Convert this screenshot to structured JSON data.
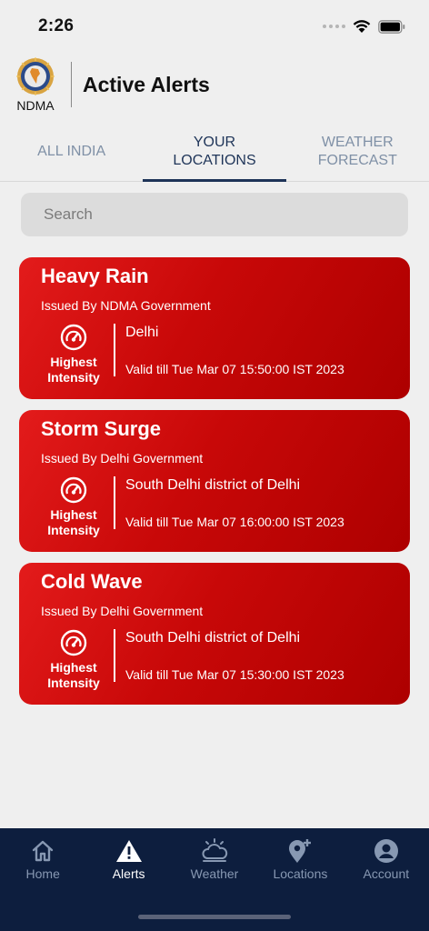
{
  "status_bar": {
    "time": "2:26"
  },
  "header": {
    "logo_caption": "NDMA",
    "title": "Active Alerts"
  },
  "tabs": [
    {
      "label": "ALL INDIA",
      "active": false
    },
    {
      "label": "YOUR\nLOCATIONS",
      "active": true
    },
    {
      "label": "WEATHER\nFORECAST",
      "active": false
    }
  ],
  "search": {
    "placeholder": "Search",
    "value": ""
  },
  "alerts": [
    {
      "title": "Heavy Rain",
      "issuer": "Issued By NDMA Government",
      "intensity": "Highest Intensity",
      "location": "Delhi",
      "validity": "Valid till Tue Mar 07 15:50:00 IST 2023"
    },
    {
      "title": "Storm Surge",
      "issuer": "Issued By Delhi Government",
      "intensity": "Highest Intensity",
      "location": "South Delhi district of Delhi",
      "validity": "Valid till Tue Mar 07 16:00:00 IST 2023"
    },
    {
      "title": "Cold Wave",
      "issuer": "Issued By Delhi Government",
      "intensity": "Highest Intensity",
      "location": "South Delhi district of Delhi",
      "validity": "Valid till Tue Mar 07 15:30:00 IST 2023"
    }
  ],
  "nav": [
    {
      "label": "Home",
      "icon": "home-icon",
      "active": false
    },
    {
      "label": "Alerts",
      "icon": "alert-triangle-icon",
      "active": true
    },
    {
      "label": "Weather",
      "icon": "weather-icon",
      "active": false
    },
    {
      "label": "Locations",
      "icon": "location-add-icon",
      "active": false
    },
    {
      "label": "Account",
      "icon": "account-icon",
      "active": false
    }
  ],
  "colors": {
    "alert_red": "#c80808",
    "nav_bg": "#0d1e3e",
    "tab_active": "#1e3458",
    "tab_inactive": "#7f90a6"
  }
}
